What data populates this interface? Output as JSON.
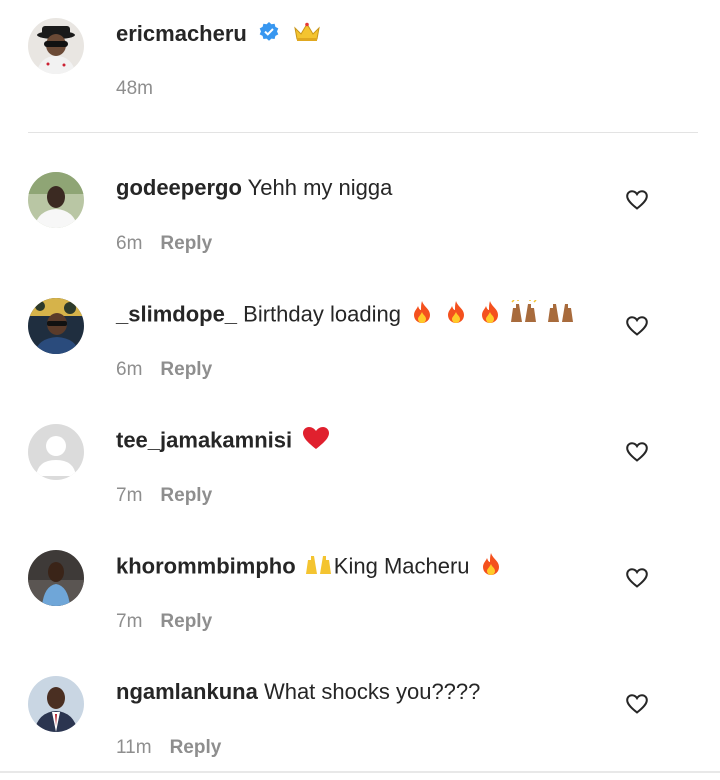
{
  "caption": {
    "username": "ericmacheru",
    "verified": true,
    "emoji_icon": "crown-icon",
    "time": "48m"
  },
  "reply_label": "Reply",
  "comments": [
    {
      "username": "godeepergo",
      "text": "Yehh my nigga",
      "time": "6m",
      "emoji_icons": []
    },
    {
      "username": "_slimdope_",
      "text": "Birthday loading",
      "time": "6m",
      "emoji_icons": [
        "fire-icon",
        "fire-icon",
        "fire-icon",
        "raised-hands-icon",
        "raised-hands-icon"
      ]
    },
    {
      "username": "tee_jamakamnisi",
      "text": "",
      "time": "7m",
      "emoji_icons": [
        "red-heart-icon"
      ]
    },
    {
      "username": "khorommbimpho",
      "text": "King Macheru",
      "time": "7m",
      "emoji_icons": [
        "raised-hands-icon",
        "fire-icon"
      ]
    },
    {
      "username": "ngamlankuna",
      "text": "What shocks you????",
      "time": "11m",
      "emoji_icons": []
    }
  ],
  "colors": {
    "primary_text": "#262626",
    "secondary_text": "#8e8e8e",
    "verified_blue": "#3897f0",
    "divider": "#e3e3e3"
  }
}
